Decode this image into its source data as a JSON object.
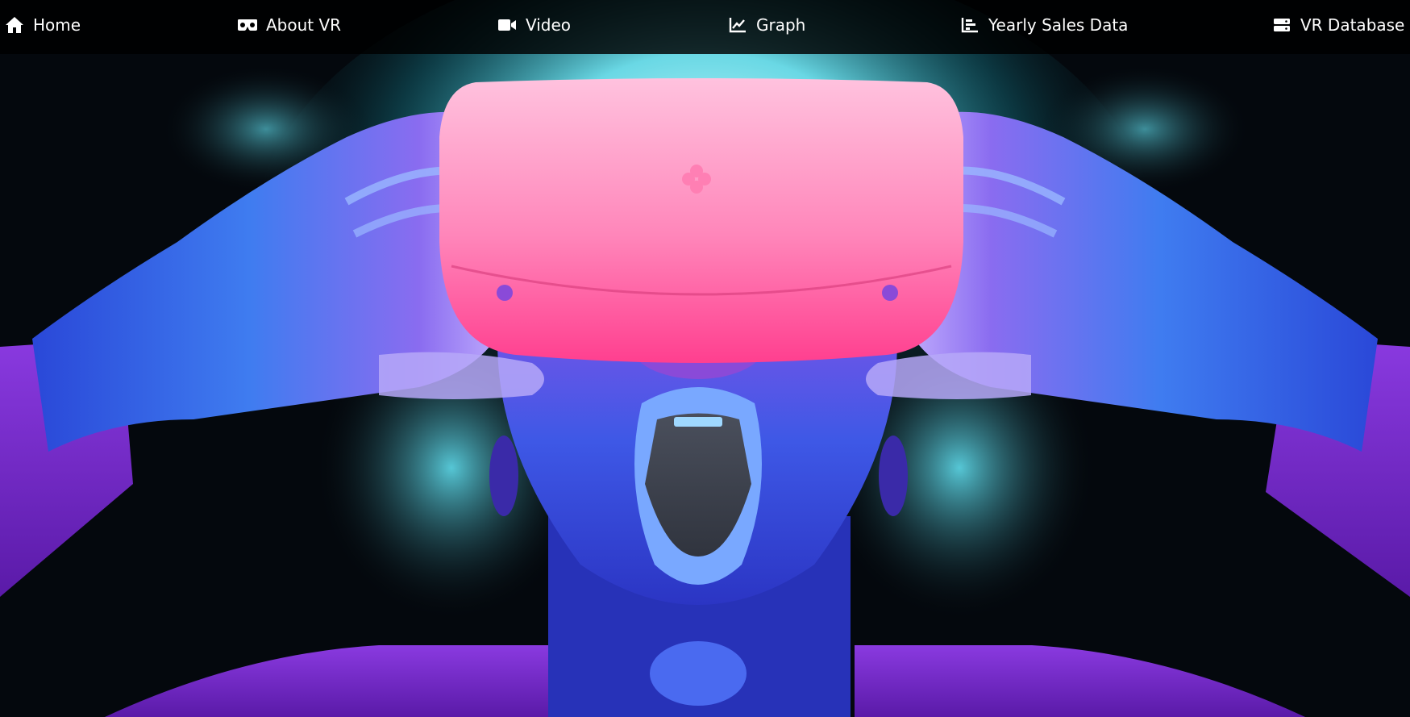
{
  "nav": {
    "home": {
      "label": "Home",
      "icon": "home-icon"
    },
    "about_vr": {
      "label": "About VR",
      "icon": "vr-headset-icon"
    },
    "video": {
      "label": "Video",
      "icon": "video-camera-icon"
    },
    "graph": {
      "label": "Graph",
      "icon": "line-chart-icon"
    },
    "yearly_sales": {
      "label": "Yearly Sales Data",
      "icon": "bar-chart-icon"
    },
    "vr_database": {
      "label": "VR Database",
      "icon": "database-server-icon"
    }
  },
  "hero": {
    "image": "vr-headset-illustration",
    "colors": {
      "background": "#04080d",
      "glow": "#7fe9f4",
      "headset": "#ff5ea0",
      "hands": "#3c57e8",
      "sleeves": "#7a2fd0"
    }
  }
}
